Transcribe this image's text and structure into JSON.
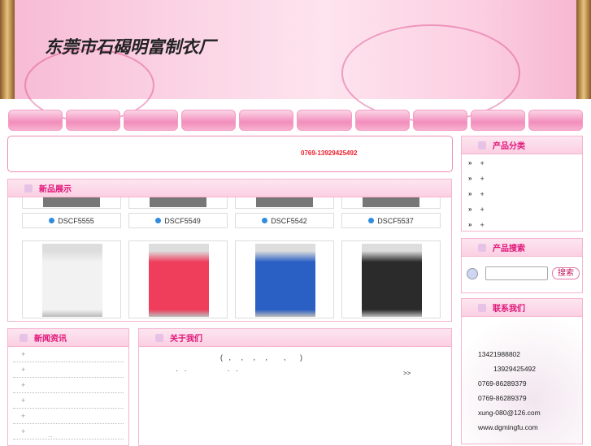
{
  "header": {
    "title": "东莞市石碣明富制衣厂"
  },
  "nav": {
    "count": 10
  },
  "info": {
    "phone": "0769-13929425492"
  },
  "new_products": {
    "title": "新品展示",
    "captions": [
      "DSCF5555",
      "DSCF5549",
      "DSCF5542",
      "DSCF5537"
    ],
    "photo_colors": [
      "#f2f2f2",
      "#ef3d5c",
      "#2a5fc4",
      "#2b2b2b"
    ]
  },
  "categories": {
    "title": "产品分类",
    "items": [
      "+",
      "+",
      "+",
      "+",
      "+"
    ],
    "arrow": "»"
  },
  "search": {
    "title": "产品搜索",
    "button": "搜索",
    "placeholder": ""
  },
  "contact": {
    "title": "联系我们",
    "lines": [
      "13421988802",
      "13929425492",
      "0769-86289379",
      "0769-86289379",
      "xung-080@126.com",
      "www.dgmingfu.com"
    ]
  },
  "news": {
    "title": "新闻资讯",
    "items": [
      "+",
      "+",
      "+",
      "+",
      "+",
      "+"
    ],
    "last_suffix": ".."
  },
  "about": {
    "title": "关于我们",
    "line1": "(   ,     ,     ,     ,        ,       )",
    "line2": "·   ·                    ·   ·",
    "more": ">>"
  }
}
